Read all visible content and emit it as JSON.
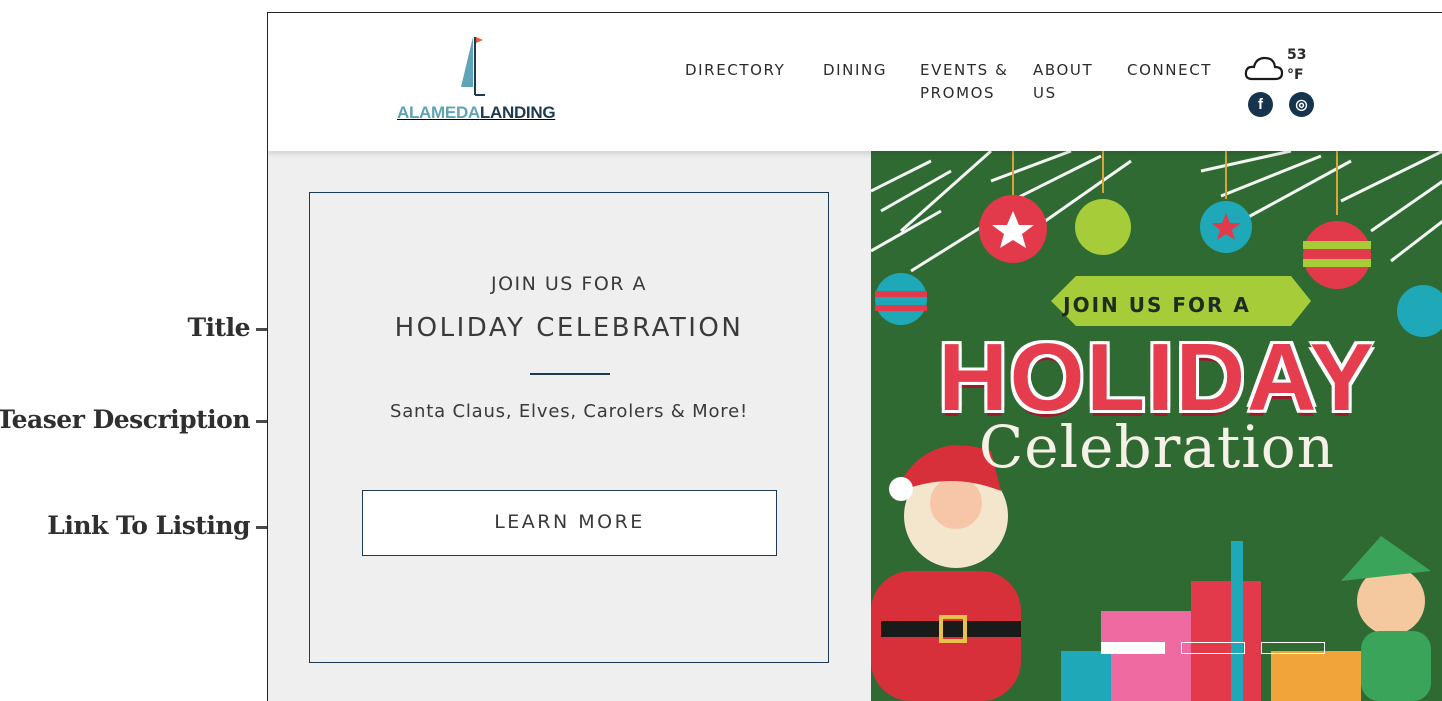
{
  "annotations": {
    "title": "Title",
    "teaser": "Teaser Description",
    "link": "Link To Listing"
  },
  "header": {
    "logo": {
      "part1": "ALAMEDA",
      "part2": "LANDING"
    },
    "nav": [
      {
        "line1": "DIRECTORY",
        "line2": ""
      },
      {
        "line1": "DINING",
        "line2": ""
      },
      {
        "line1": "EVENTS &",
        "line2": "PROMOS"
      },
      {
        "line1": "ABOUT",
        "line2": "US"
      },
      {
        "line1": "CONNECT",
        "line2": ""
      }
    ],
    "weather": {
      "icon": "cloud-icon",
      "temp": "53",
      "unit": "°F"
    },
    "social": [
      {
        "icon": "facebook-icon",
        "glyph": "f"
      },
      {
        "icon": "instagram-icon",
        "glyph": "◎"
      }
    ]
  },
  "promo": {
    "kicker": "JOIN US FOR A",
    "title": "HOLIDAY CELEBRATION",
    "teaser": "Santa Claus, Elves, Carolers & More!",
    "cta": "LEARN MORE"
  },
  "hero": {
    "join": "JOIN US FOR A",
    "holiday": "HOLIDAY",
    "celebration": "Celebration",
    "slides": 3,
    "active_slide": 1
  },
  "colors": {
    "navy": "#1d3a52",
    "teal": "#5ea3b6",
    "hero_green": "#2f6a33",
    "holiday_red": "#e53d4e"
  }
}
